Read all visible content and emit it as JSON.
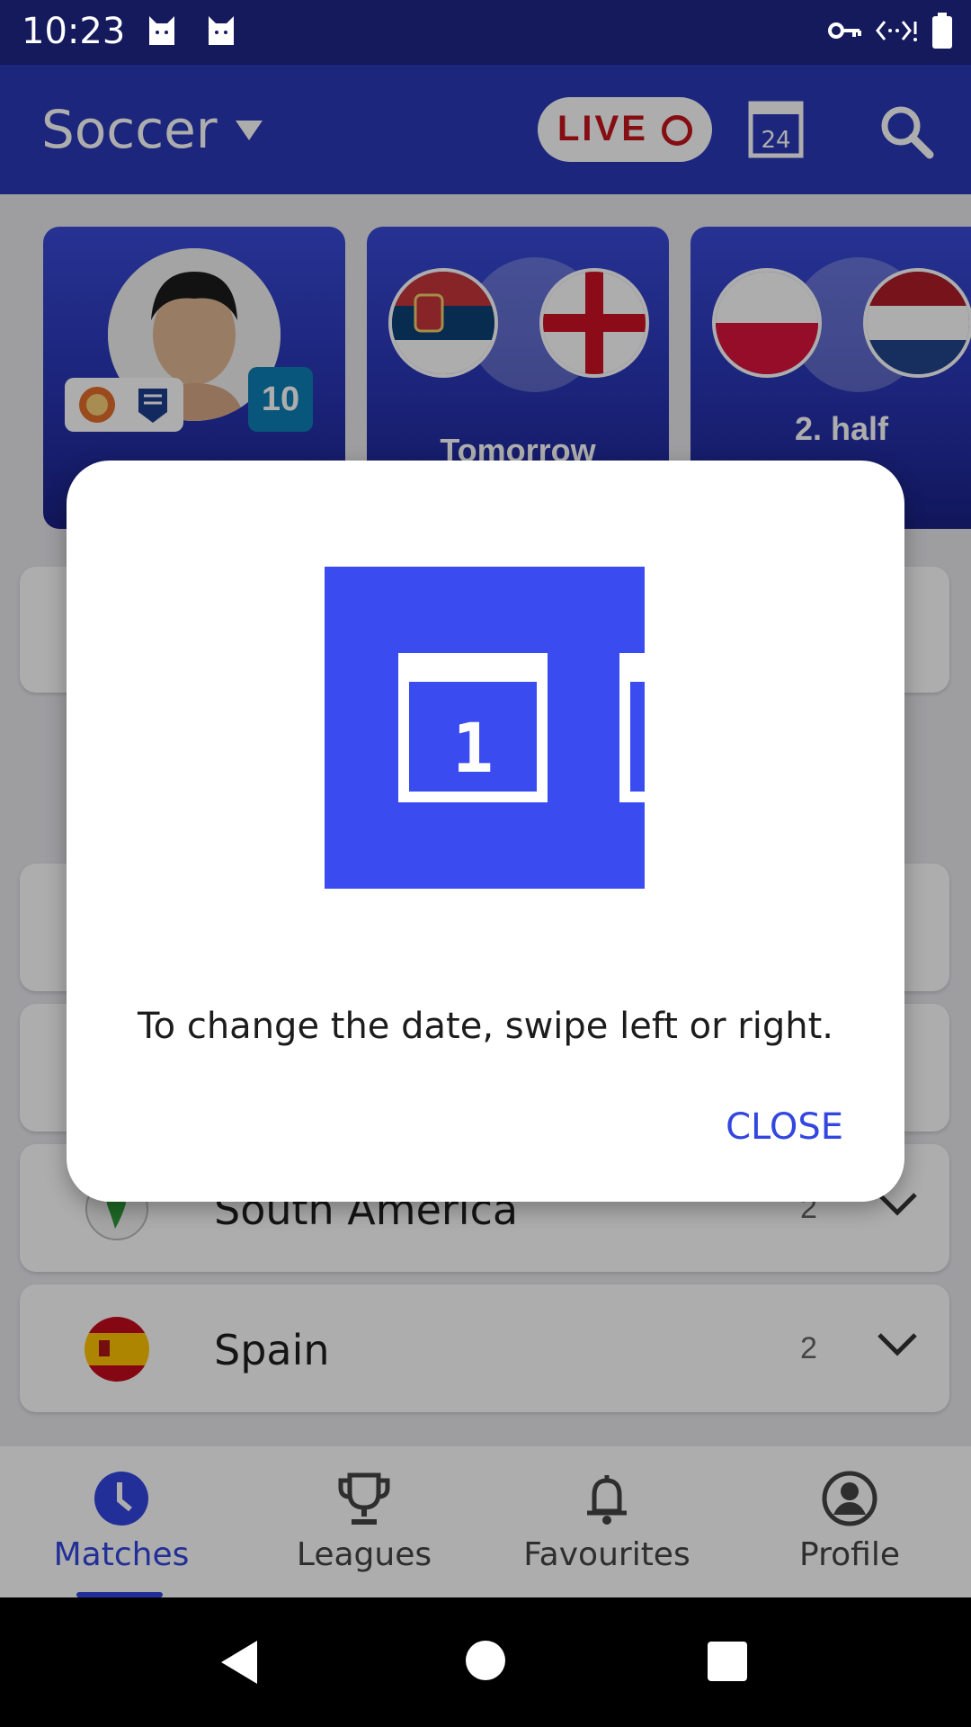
{
  "status_bar": {
    "time": "10:23"
  },
  "header": {
    "sport": "Soccer",
    "live_label": "LIVE",
    "calendar_day": "24"
  },
  "cards": [
    {
      "badge_number": "10"
    },
    {
      "label": "Tomorrow"
    },
    {
      "label": "2. half"
    }
  ],
  "list": {
    "rows": [
      {
        "name": "South America",
        "count": "2"
      },
      {
        "name": "Spain",
        "count": "2"
      }
    ]
  },
  "bottom_nav": {
    "items": [
      {
        "label": "Matches"
      },
      {
        "label": "Leagues"
      },
      {
        "label": "Favourites"
      },
      {
        "label": "Profile"
      }
    ]
  },
  "dialog": {
    "illustration_day": "1",
    "message": "To change the date, swipe left or right.",
    "close_label": "CLOSE"
  },
  "colors": {
    "brand_blue": "#2a39b7",
    "accent_blue": "#3346e0",
    "live_red": "#c4161c"
  }
}
